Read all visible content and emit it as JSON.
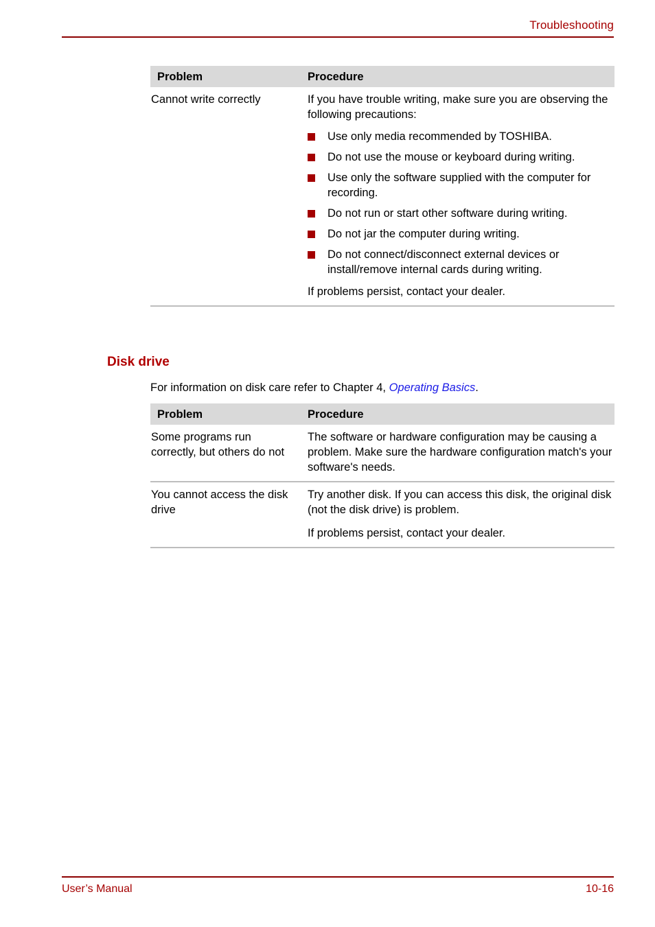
{
  "header": {
    "title": "Troubleshooting"
  },
  "tables": [
    {
      "columns": [
        "Problem",
        "Procedure"
      ],
      "rows": [
        {
          "problem": "Cannot write correctly",
          "intro": "If you have trouble writing, make sure you are observing the following precautions:",
          "bullets": [
            "Use only media recommended by TOSHIBA.",
            "Do not use the mouse or keyboard during writing.",
            "Use only the software supplied with the computer for recording.",
            "Do not run or start other software during writing.",
            "Do not jar the computer during writing.",
            "Do not connect/disconnect external devices or install/remove internal cards during writing."
          ],
          "outro": "If problems persist, contact your dealer."
        }
      ]
    },
    {
      "columns": [
        "Problem",
        "Procedure"
      ],
      "rows": [
        {
          "problem": "Some programs run correctly, but others do not",
          "procedure": "The software or hardware configuration may be causing a problem. Make sure the hardware configuration match's your software's needs."
        },
        {
          "problem": "You cannot access the disk drive",
          "procedure": "Try another disk. If you can access this disk, the original disk (not the disk drive) is problem.",
          "procedure2": "If problems persist, contact your dealer."
        }
      ]
    }
  ],
  "section": {
    "heading": "Disk drive",
    "intro_before": "For information on disk care refer to Chapter 4, ",
    "intro_link": "Operating Basics",
    "intro_after": "."
  },
  "footer": {
    "left": "User’s Manual",
    "right": "10-16"
  },
  "colors": {
    "accent_red": "#a50000",
    "rule_red": "#8c0000",
    "bullet_red": "#a30000",
    "table_header_bg": "#d9d9d9",
    "row_divider": "#bdbdbd",
    "link_blue": "#1a1ae6"
  }
}
